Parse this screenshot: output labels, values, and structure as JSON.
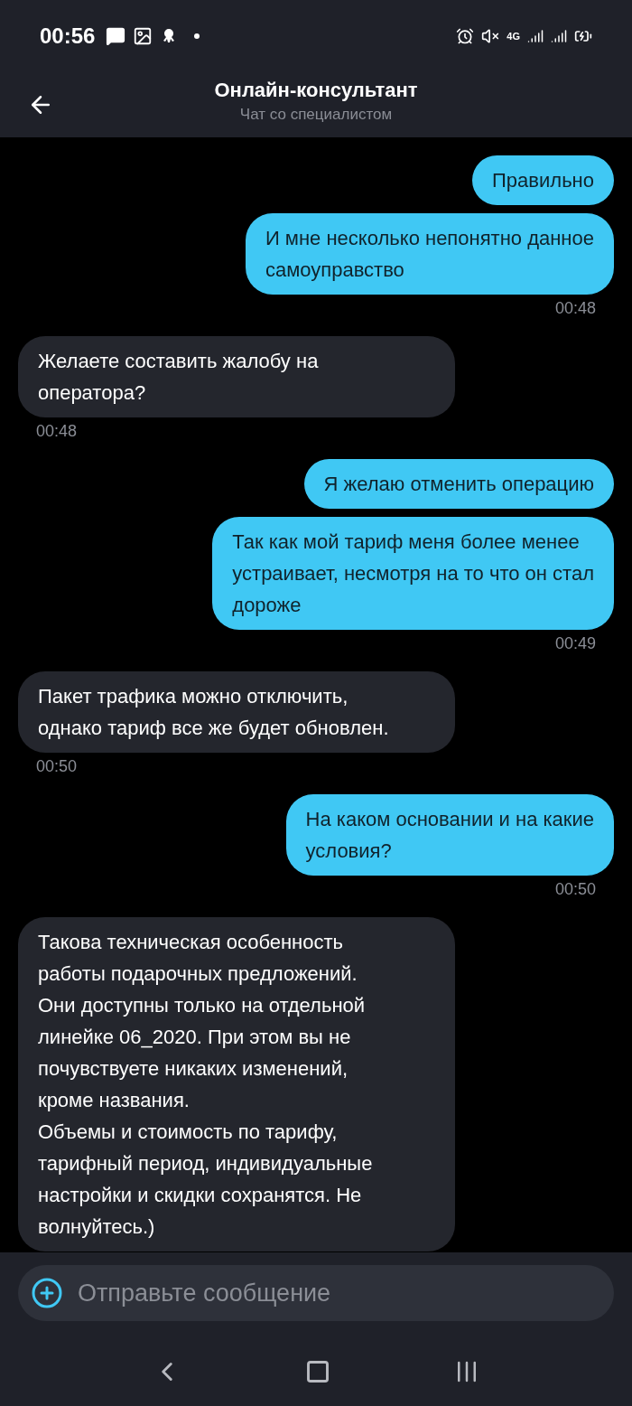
{
  "status_bar": {
    "time": "00:56",
    "network": "4G"
  },
  "header": {
    "title": "Онлайн-консультант",
    "subtitle": "Чат со специалистом"
  },
  "messages": [
    {
      "kind": "out",
      "text": "Правильно"
    },
    {
      "kind": "out",
      "text": "И мне несколько непонятно данное\nсамоуправство",
      "time": "00:48"
    },
    {
      "kind": "in",
      "text": "Желаете составить жалобу на\nоператора?",
      "time": "00:48"
    },
    {
      "kind": "out",
      "text": "Я желаю отменить операцию"
    },
    {
      "kind": "out",
      "text": "Так как мой тариф меня более менее\nустраивает, несмотря на то что он стал\nдороже",
      "time": "00:49"
    },
    {
      "kind": "in",
      "text": "Пакет трафика можно отключить,\nоднако тариф все же будет обновлен.",
      "time": "00:50"
    },
    {
      "kind": "out",
      "text": "На каком основании и на какие\nусловия?",
      "time": "00:50"
    },
    {
      "kind": "in",
      "text": "Такова техническая особенность\nработы подарочных предложений.\nОни доступны только на отдельной\nлинейке 06_2020. При этом вы не\nпочувствуете никаких изменений,\nкроме названия.\nОбъемы и стоимость по тарифу,\nтарифный период, индивидуальные\nнастройки и скидки сохранятся. Не\nволнуйтесь.)"
    }
  ],
  "composer": {
    "placeholder": "Отправьте сообщение"
  }
}
